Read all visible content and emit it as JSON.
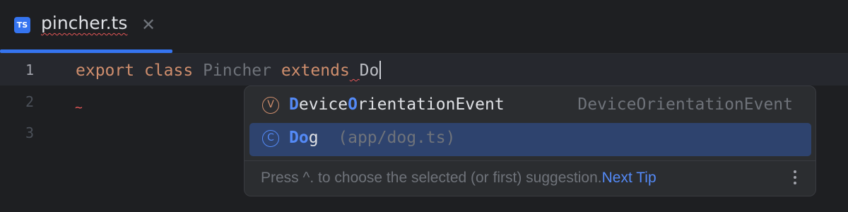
{
  "tab": {
    "badge": "TS",
    "filename": "pincher.ts",
    "close_glyph": "✕"
  },
  "editor": {
    "line_numbers": [
      "1",
      "2",
      "3"
    ],
    "line1": {
      "kw1": "export",
      "kw2": "class",
      "class_name": "Pincher",
      "kw3": "extends",
      "typed": "Do"
    },
    "error_marker": "~"
  },
  "completion": {
    "items": [
      {
        "icon_letter": "V",
        "icon": "variable-icon",
        "match": "D",
        "text_mid": "evice",
        "match2": "O",
        "text_rest": "rientationEvent",
        "type": "DeviceOrientationEvent"
      },
      {
        "icon_letter": "C",
        "icon": "class-icon",
        "match": "Do",
        "text_rest": "g",
        "hint": "(app/dog.ts)"
      }
    ],
    "footer": {
      "text": "Press ^. to choose the selected (or first) suggestion.",
      "link": "Next Tip"
    }
  },
  "colors": {
    "accent": "#3574f0",
    "keyword": "#cf8e6d",
    "error": "#e55757",
    "selection": "#2e436e"
  }
}
